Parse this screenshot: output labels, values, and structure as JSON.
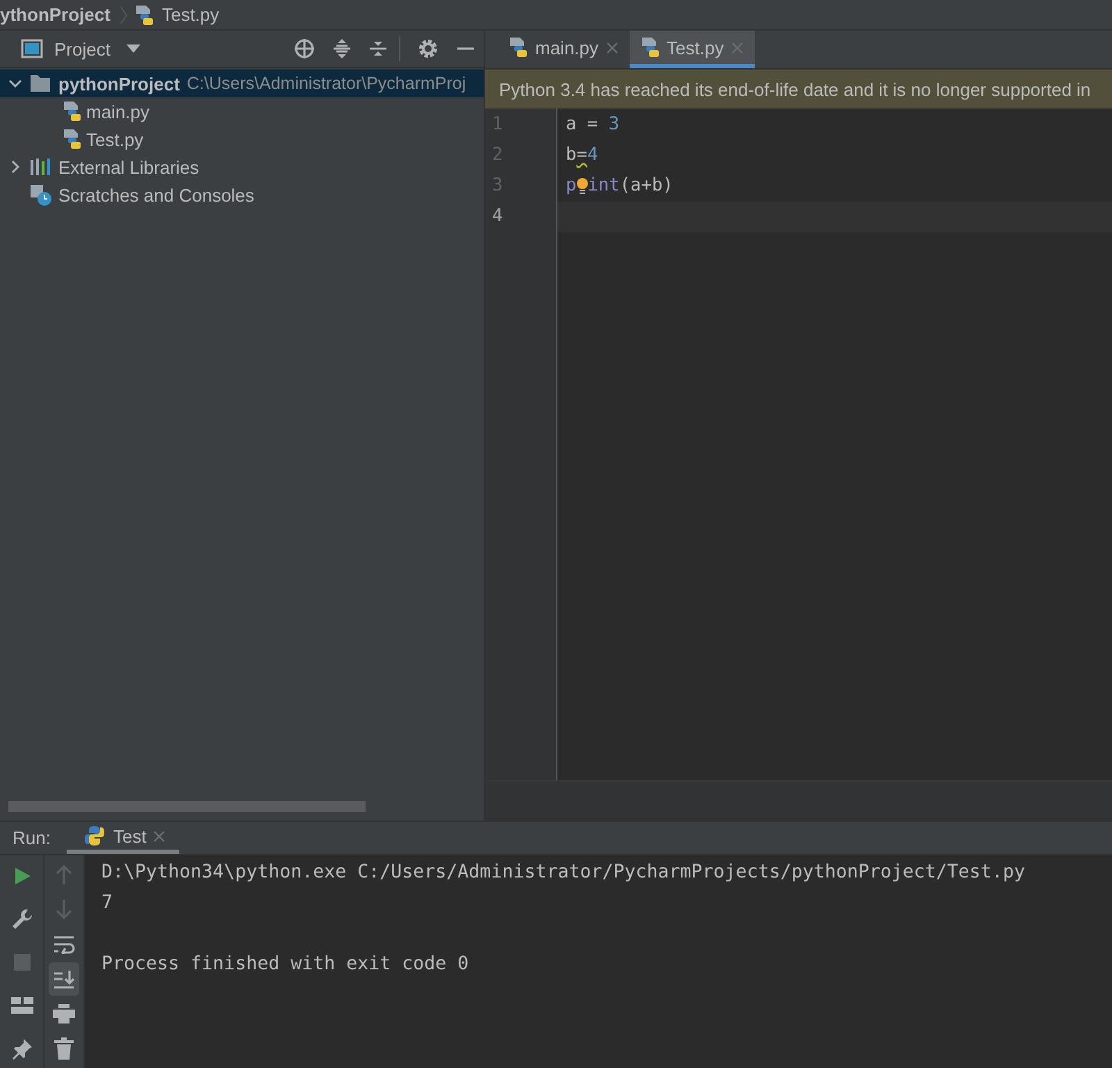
{
  "breadcrumb": [
    {
      "text": "ythonProject",
      "kind": "project"
    },
    {
      "text": "Test.py",
      "kind": "file"
    }
  ],
  "project_panel": {
    "title": "Project",
    "tree": [
      {
        "label": "pythonProject",
        "path": "C:\\Users\\Administrator\\PycharmProj",
        "kind": "folder",
        "expanded": true,
        "selected": true,
        "children": [
          {
            "label": "main.py",
            "kind": "python",
            "selected": false
          },
          {
            "label": "Test.py",
            "kind": "python",
            "selected": false
          }
        ]
      },
      {
        "label": "External Libraries",
        "kind": "libraries",
        "expanded": false,
        "selected": false
      },
      {
        "label": "Scratches and Consoles",
        "kind": "scratches",
        "selected": false
      }
    ]
  },
  "editor": {
    "tabs": [
      {
        "label": "main.py",
        "selected": false
      },
      {
        "label": "Test.py",
        "selected": true
      }
    ],
    "banner": "Python 3.4 has reached its end-of-life date and it is no longer supported in",
    "lines": [
      {
        "number": "1",
        "current": false,
        "tokens": [
          {
            "text": "a = ",
            "kind": "plain"
          },
          {
            "text": "3",
            "kind": "number"
          }
        ]
      },
      {
        "number": "2",
        "current": false,
        "tokens": [
          {
            "text": "b",
            "kind": "plain"
          },
          {
            "text": "=",
            "kind": "plain",
            "warning": true
          },
          {
            "text": "4",
            "kind": "number"
          }
        ]
      },
      {
        "number": "3",
        "current": false,
        "tokens": [
          {
            "text": "p",
            "kind": "builtin"
          },
          {
            "kind": "bulb"
          },
          {
            "text": "int",
            "kind": "builtin"
          },
          {
            "text": "(a+b)",
            "kind": "plain"
          }
        ]
      },
      {
        "number": "4",
        "current": true
      }
    ]
  },
  "run": {
    "label": "Run:",
    "tabs": [
      {
        "label": "Test",
        "selected": true
      }
    ],
    "toolbar_left": [
      {
        "kind": "run",
        "disabled": false
      },
      {
        "kind": "wrench",
        "disabled": false
      },
      {
        "kind": "stop",
        "disabled": true
      },
      {
        "kind": "layout",
        "disabled": false
      },
      {
        "kind": "pin",
        "disabled": false
      }
    ],
    "toolbar_right": [
      {
        "kind": "up",
        "disabled": true,
        "on": false
      },
      {
        "kind": "down",
        "disabled": true,
        "on": false
      },
      {
        "kind": "wrap",
        "disabled": false,
        "on": false
      },
      {
        "kind": "scroll_end",
        "disabled": false,
        "on": true
      },
      {
        "kind": "print",
        "disabled": false,
        "on": false
      },
      {
        "kind": "trash",
        "disabled": false,
        "on": false
      }
    ],
    "output": [
      {
        "text": "D:\\Python34\\python.exe C:/Users/Administrator/PycharmProjects/pythonProject/Test.py",
        "kind": "command"
      },
      {
        "text": "7",
        "kind": "stdout"
      },
      {
        "text": "Process finished with exit code 0",
        "kind": "status"
      }
    ]
  }
}
